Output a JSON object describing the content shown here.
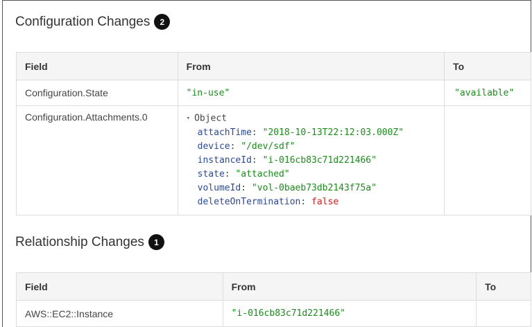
{
  "config": {
    "title": "Configuration Changes",
    "badge": "2",
    "headers": {
      "field": "Field",
      "from": "From",
      "to": "To"
    },
    "row1": {
      "field": "Configuration.State",
      "from": "\"in-use\"",
      "to": "\"available\""
    },
    "row2": {
      "field": "Configuration.Attachments.0",
      "caret": "▾",
      "object_label": "Object",
      "props": [
        {
          "key": "attachTime",
          "value": "\"2018-10-13T22:12:03.000Z\""
        },
        {
          "key": "device",
          "value": "\"/dev/sdf\""
        },
        {
          "key": "instanceId",
          "value": "\"i-016cb83c71d221466\""
        },
        {
          "key": "state",
          "value": "\"attached\""
        },
        {
          "key": "volumeId",
          "value": "\"vol-0baeb73db2143f75a\""
        },
        {
          "key": "deleteOnTermination",
          "value": "false"
        }
      ]
    }
  },
  "relationship": {
    "title": "Relationship Changes",
    "badge": "1",
    "headers": {
      "field": "Field",
      "from": "From",
      "to": "To"
    },
    "row1": {
      "field": "AWS::EC2::Instance",
      "from": "\"i-016cb83c71d221466\"",
      "to": ""
    }
  },
  "colors": {
    "string": "#1a8d1a",
    "key": "#2a4a9b",
    "boolean": "#d62020",
    "badge": "#111111"
  }
}
